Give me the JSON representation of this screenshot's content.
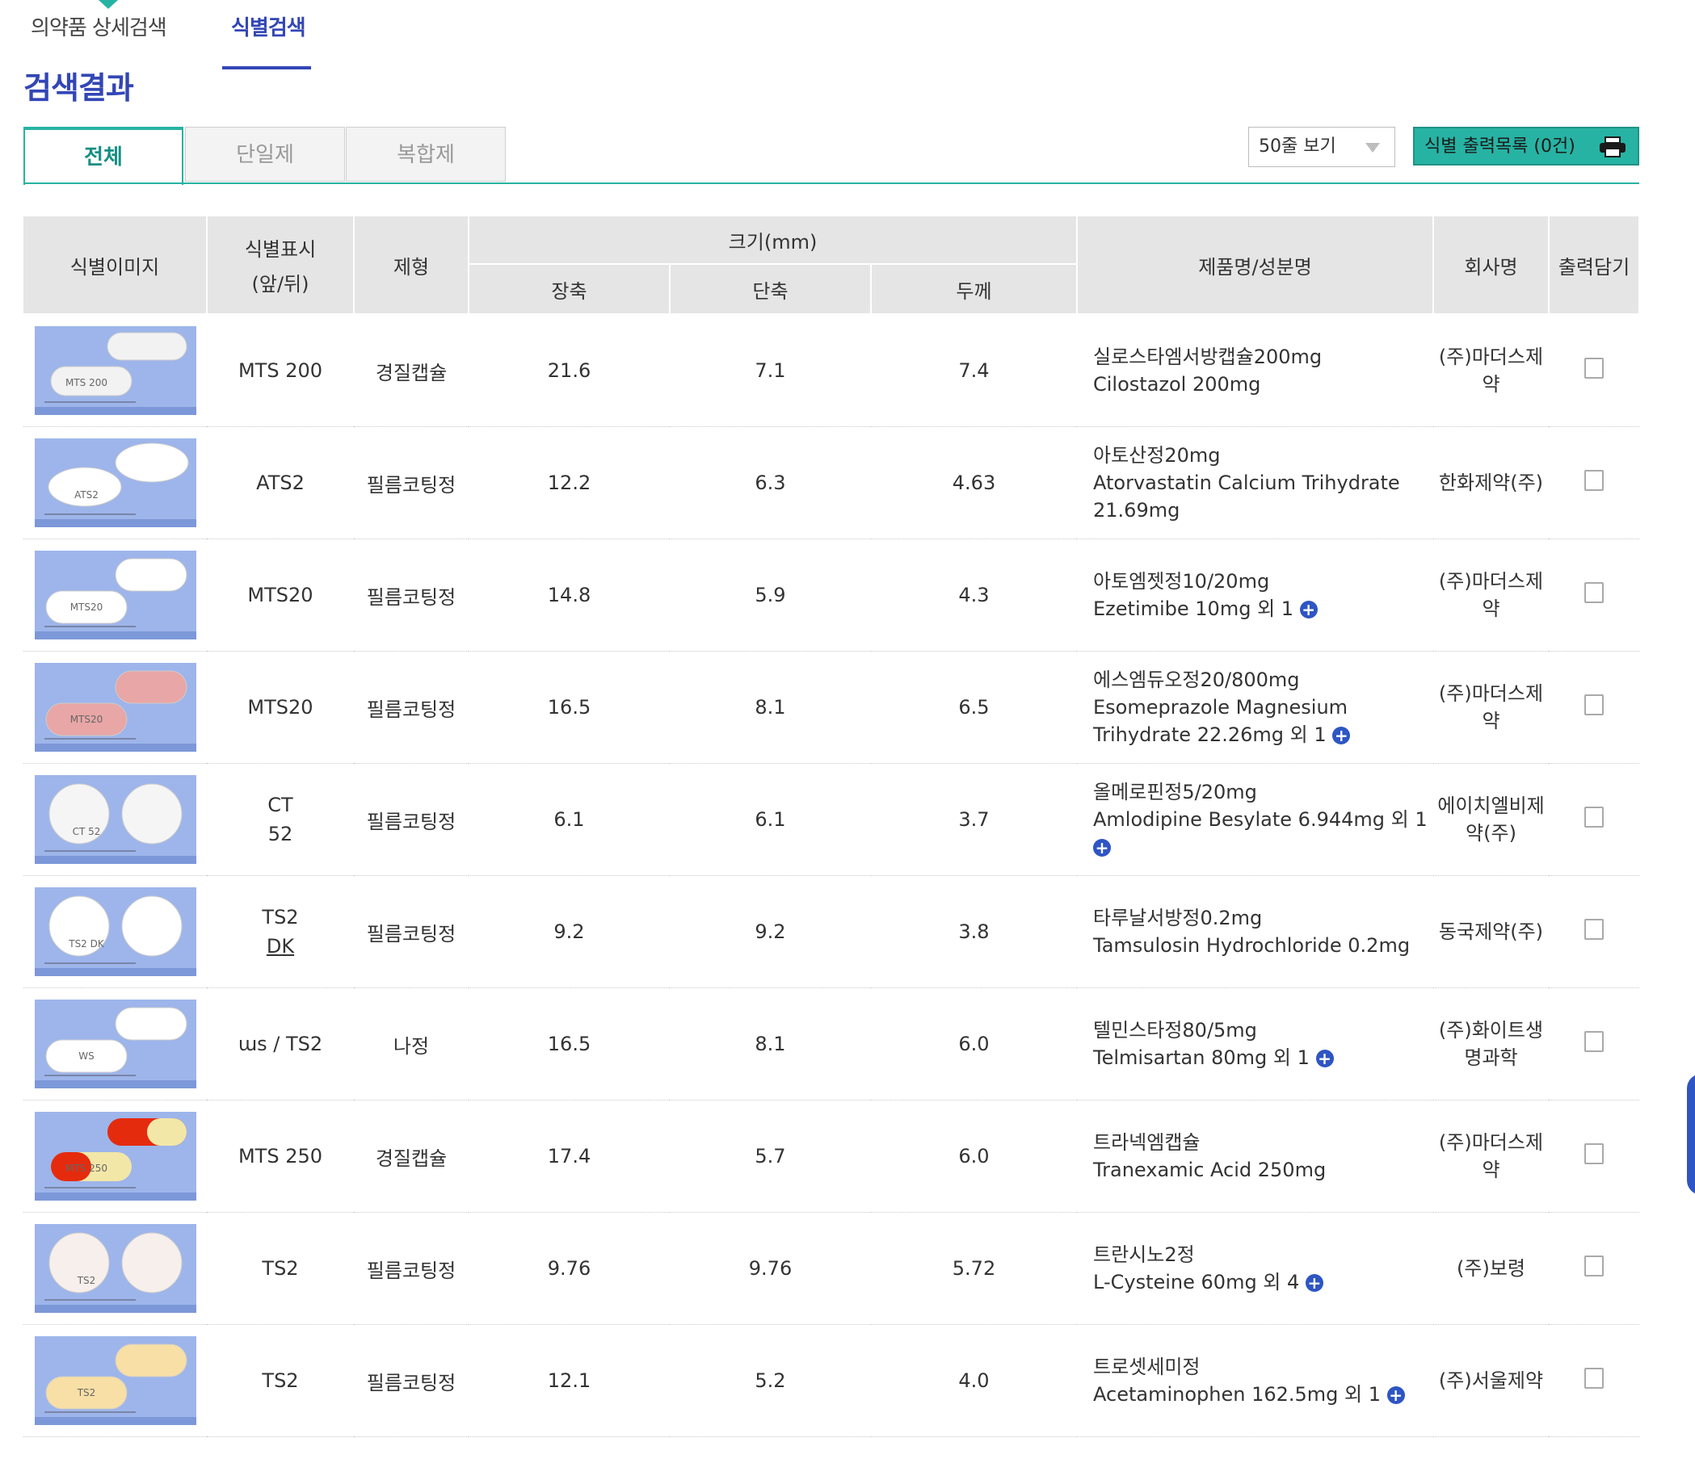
{
  "top_tabs": {
    "detail_search": "의약품 상세검색",
    "identify_search": "식별검색"
  },
  "section_title": "검색결과",
  "category_tabs": [
    "전체",
    "단일제",
    "복합제"
  ],
  "rows_select": "50줄 보기",
  "print_list": "식별 출력목록 (0건)",
  "headers": {
    "image": "식별이미지",
    "mark": "식별표시",
    "mark_sub": "(앞/뒤)",
    "form": "제형",
    "size": "크기(mm)",
    "long": "장축",
    "short": "단축",
    "thick": "두께",
    "product": "제품명/성분명",
    "company": "회사명",
    "print": "출력담기"
  },
  "rows": [
    {
      "mark": "MTS 200",
      "form": "경질캡슐",
      "long": "21.6",
      "short": "7.1",
      "thick": "7.4",
      "product": "실로스타엠서방캡슐200mg",
      "ingredient": "Cilostazol   200mg",
      "company": "(주)마더스제약",
      "has_more": false,
      "pill_color": "#f2f2f2",
      "pill_shape": "capsule",
      "imprint": "MTS  200"
    },
    {
      "mark": "ATS2",
      "form": "필름코팅정",
      "long": "12.2",
      "short": "6.3",
      "thick": "4.63",
      "product": "아토산정20mg",
      "ingredient": "Atorvastatin Calcium Trihydrate 21.69mg",
      "company": "한화제약(주)",
      "has_more": false,
      "pill_color": "#ffffff",
      "pill_shape": "oval",
      "imprint": "ATS2"
    },
    {
      "mark": "MTS20",
      "form": "필름코팅정",
      "long": "14.8",
      "short": "5.9",
      "thick": "4.3",
      "product": "아토엠젯정10/20mg",
      "ingredient": "Ezetimibe   10mg 외 1",
      "company": "(주)마더스제약",
      "has_more": true,
      "pill_color": "#ffffff",
      "pill_shape": "oblong",
      "imprint": "MTS20"
    },
    {
      "mark": "MTS20",
      "form": "필름코팅정",
      "long": "16.5",
      "short": "8.1",
      "thick": "6.5",
      "product": "에스엠듀오정20/800mg",
      "ingredient": "Esomeprazole Magnesium Trihydrate   22.26mg 외 1",
      "company": "(주)마더스제약",
      "has_more": true,
      "pill_color": "#e9a6a6",
      "pill_shape": "oblong",
      "imprint": "MTS20"
    },
    {
      "mark": "CT 52",
      "form": "필름코팅정",
      "long": "6.1",
      "short": "6.1",
      "thick": "3.7",
      "product": "올메로핀정5/20mg",
      "ingredient": "Amlodipine Besylate   6.944mg 외 1",
      "company": "에이치엘비제약(주)",
      "has_more": true,
      "pill_color": "#f5f5f5",
      "pill_shape": "round",
      "imprint": "CT 52"
    },
    {
      "mark": "TS2 DK",
      "form": "필름코팅정",
      "long": "9.2",
      "short": "9.2",
      "thick": "3.8",
      "product": "타루날서방정0.2mg",
      "ingredient": "Tamsulosin Hydrochloride   0.2mg",
      "company": "동국제약(주)",
      "has_more": false,
      "pill_color": "#ffffff",
      "pill_shape": "round",
      "imprint": "TS2 DK"
    },
    {
      "mark": "ɯs / TS2",
      "form": "나정",
      "long": "16.5",
      "short": "8.1",
      "thick": "6.0",
      "product": "텔민스타정80/5mg",
      "ingredient": "Telmisartan   80mg 외 1",
      "company": "(주)화이트생명과학",
      "has_more": true,
      "pill_color": "#ffffff",
      "pill_shape": "oblong",
      "imprint": "WS"
    },
    {
      "mark": "MTS 250",
      "form": "경질캡슐",
      "long": "17.4",
      "short": "5.7",
      "thick": "6.0",
      "product": "트라넥엠캡슐",
      "ingredient": "Tranexamic Acid   250mg",
      "company": "(주)마더스제약",
      "has_more": false,
      "pill_color": "#e52b0e",
      "pill_shape": "capsule2",
      "imprint": "MTS  250"
    },
    {
      "mark": "TS2",
      "form": "필름코팅정",
      "long": "9.76",
      "short": "9.76",
      "thick": "5.72",
      "product": "트란시노2정",
      "ingredient": "L-Cysteine   60mg 외 4",
      "company": "(주)보령",
      "has_more": true,
      "pill_color": "#f7efeb",
      "pill_shape": "round",
      "imprint": "TS2"
    },
    {
      "mark": "TS2",
      "form": "필름코팅정",
      "long": "12.1",
      "short": "5.2",
      "thick": "4.0",
      "product": "트로셋세미정",
      "ingredient": "Acetaminophen   162.5mg 외 1",
      "company": "(주)서울제약",
      "has_more": true,
      "pill_color": "#f8dfa5",
      "pill_shape": "oblong",
      "imprint": "TS2"
    }
  ]
}
